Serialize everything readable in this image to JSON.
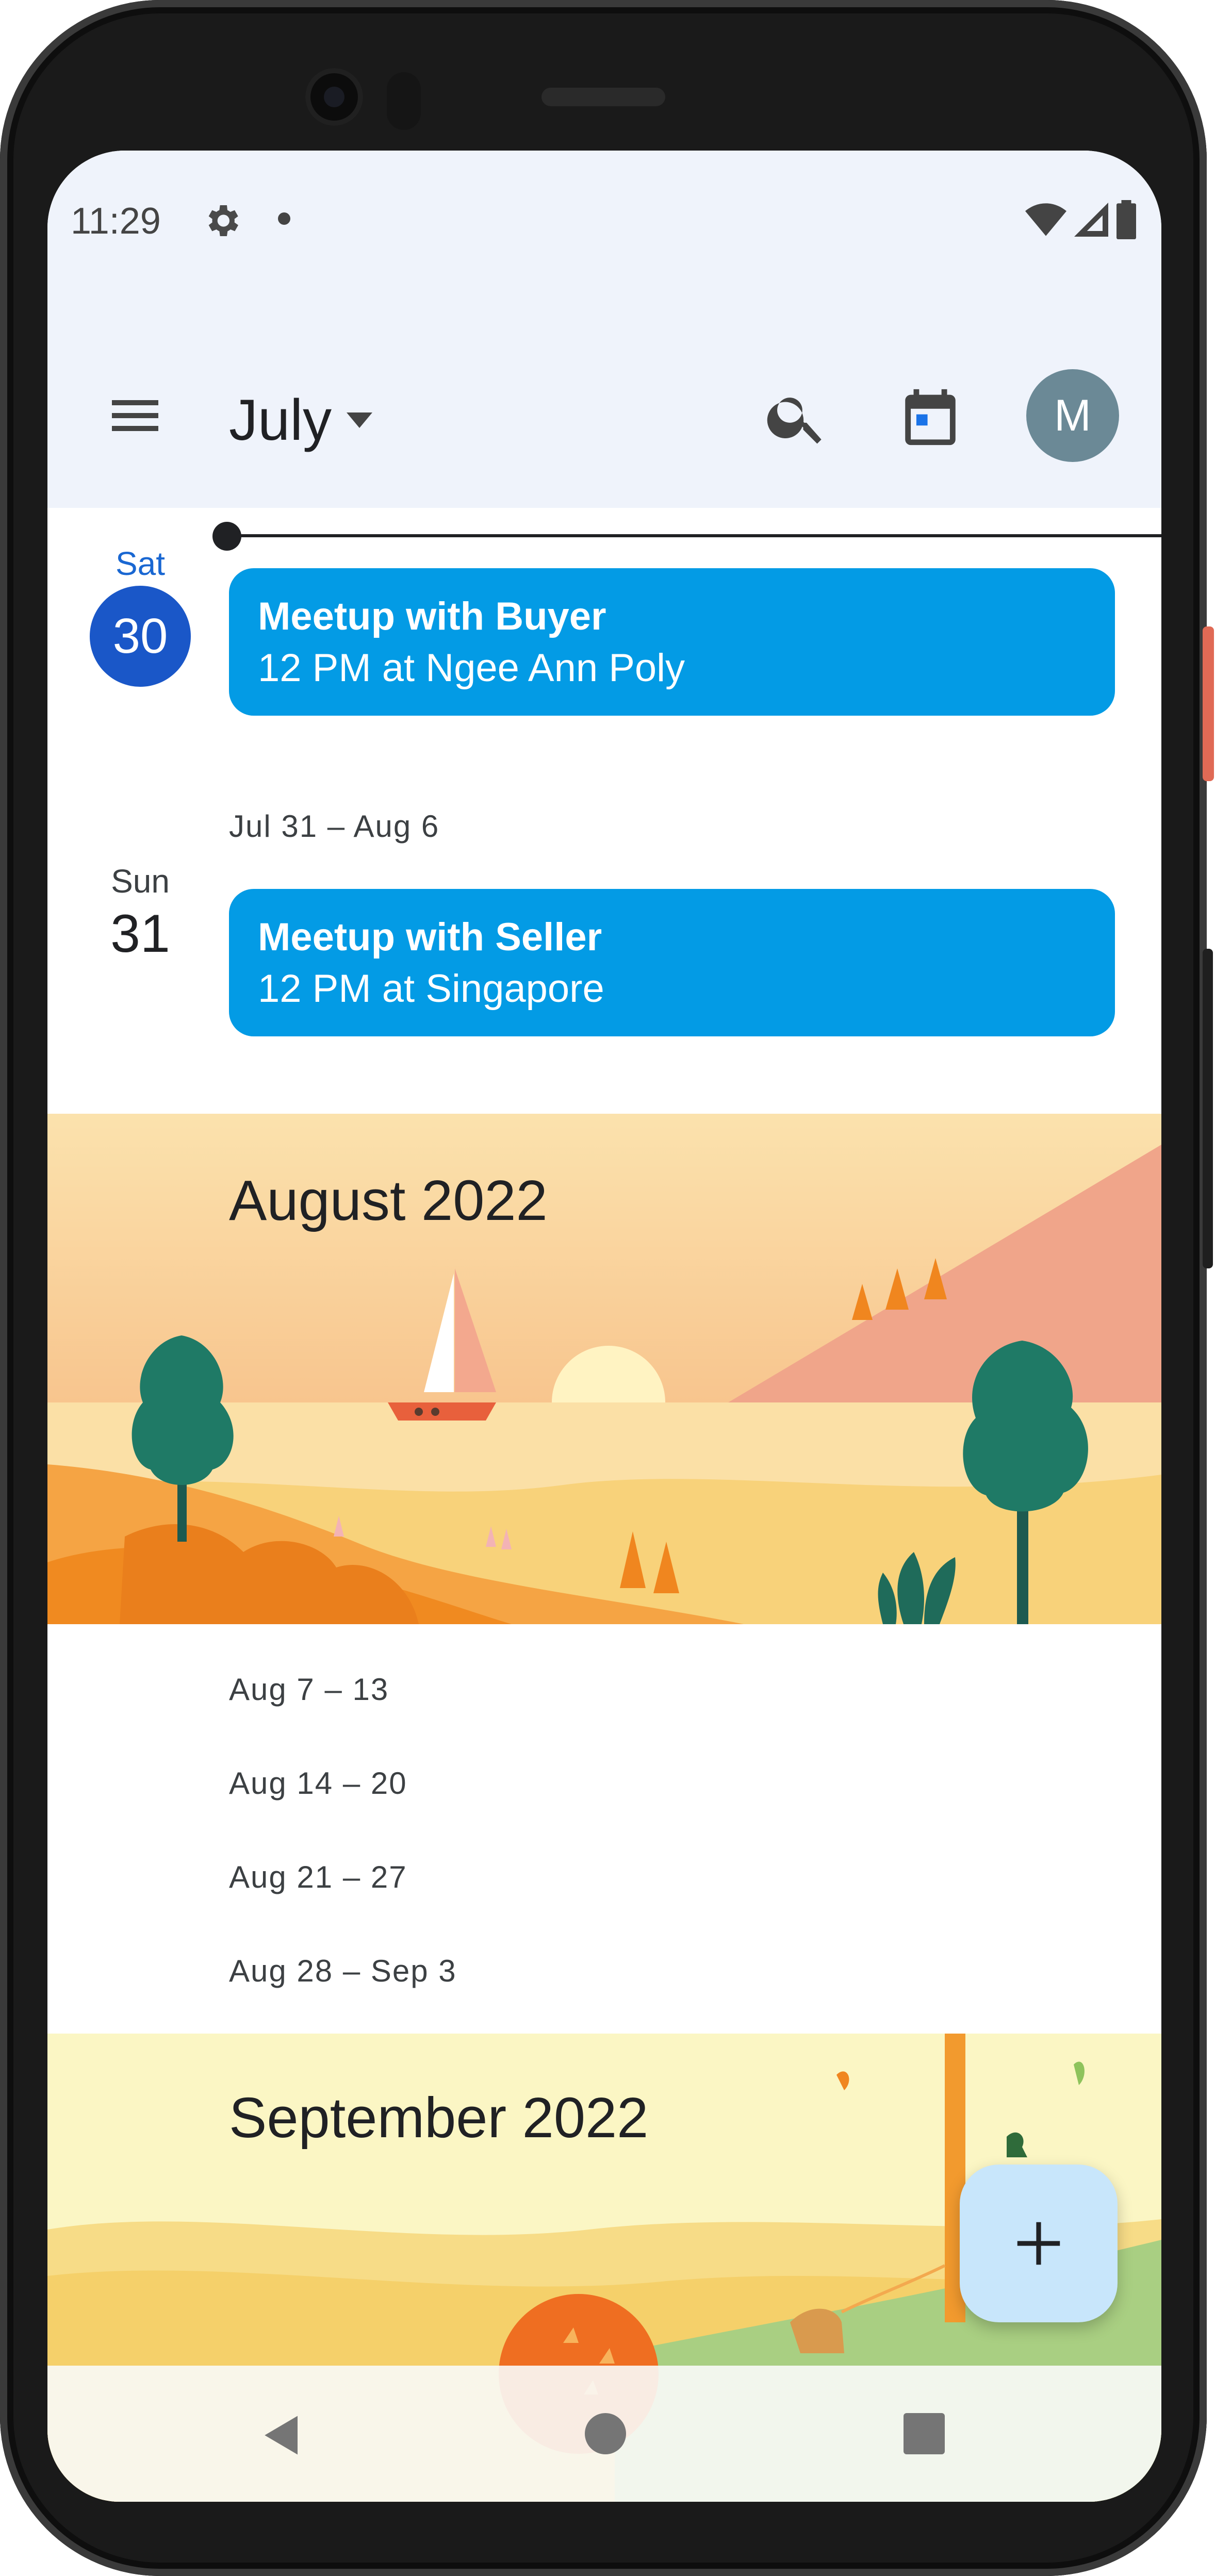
{
  "status_bar": {
    "time": "11:29",
    "left_icons": [
      "gear-icon",
      "notification-dot-icon"
    ],
    "right_icons": [
      "wifi-icon",
      "cell-signal-icon",
      "battery-icon"
    ]
  },
  "app_bar": {
    "month_label": "July",
    "menu_icon": "hamburger-menu-icon",
    "dropdown_icon": "caret-down-icon",
    "search_icon": "search-icon",
    "today_icon": "calendar-today-icon",
    "avatar_initial": "M",
    "avatar_color": "#6b8996"
  },
  "schedule": {
    "days": [
      {
        "day_name": "Sat",
        "day_number": "30",
        "is_today": true,
        "event": {
          "title": "Meetup with Buyer",
          "detail": "12 PM at Ngee Ann Poly",
          "color": "#039be5"
        }
      },
      {
        "week_label": "Jul 31 – Aug 6",
        "day_name": "Sun",
        "day_number": "31",
        "is_today": false,
        "event": {
          "title": "Meetup with Seller",
          "detail": "12 PM at Singapore",
          "color": "#039be5"
        }
      }
    ],
    "august": {
      "banner_title": "August 2022",
      "weeks": [
        "Aug 7 – 13",
        "Aug 14 – 20",
        "Aug 21 – 27",
        "Aug 28 – Sep 3"
      ]
    },
    "september": {
      "banner_title": "September 2022"
    }
  },
  "fab": {
    "icon": "plus-icon",
    "background": "#c8e6fb"
  },
  "nav_bar": {
    "icons": [
      "back-triangle-icon",
      "home-circle-icon",
      "recents-square-icon"
    ]
  },
  "colors": {
    "today_circle": "#1a57c8",
    "event": "#039be5",
    "header_bg": "#eff3fb"
  }
}
